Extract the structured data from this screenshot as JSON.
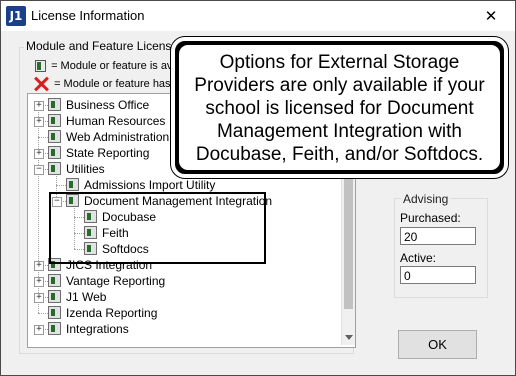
{
  "window": {
    "title": "License Information",
    "app_icon_text": "J1",
    "close_glyph": "✕"
  },
  "group": {
    "title": "Module and Feature Licenses",
    "legend_licensed": "= Module or feature is ava",
    "legend_unlicensed": "= Module or feature has n"
  },
  "tree": {
    "items": [
      {
        "label": "Business Office",
        "level": 0,
        "expander": "+"
      },
      {
        "label": "Human Resources",
        "level": 0,
        "expander": "+"
      },
      {
        "label": "Web Administration",
        "level": 0,
        "expander": ""
      },
      {
        "label": "State Reporting",
        "level": 0,
        "expander": "+"
      },
      {
        "label": "Utilities",
        "level": 0,
        "expander": "−"
      },
      {
        "label": "Admissions Import Utility",
        "level": 1,
        "expander": ""
      },
      {
        "label": "Document Management Integration",
        "level": 1,
        "expander": "−"
      },
      {
        "label": "Docubase",
        "level": 2,
        "expander": ""
      },
      {
        "label": "Feith",
        "level": 2,
        "expander": ""
      },
      {
        "label": "Softdocs",
        "level": 2,
        "expander": ""
      },
      {
        "label": "JICS Integration",
        "level": 0,
        "expander": "+"
      },
      {
        "label": "Vantage Reporting",
        "level": 0,
        "expander": "+"
      },
      {
        "label": "J1 Web",
        "level": 0,
        "expander": "+"
      },
      {
        "label": "Izenda Reporting",
        "level": 0,
        "expander": ""
      },
      {
        "label": "Integrations",
        "level": 0,
        "expander": "+"
      }
    ]
  },
  "advising": {
    "title": "Advising",
    "purchased_label": "Purchased:",
    "purchased_value": "20",
    "active_label": "Active:",
    "active_value": "0"
  },
  "ok_label": "OK",
  "callout": {
    "text": "Options for External Storage Providers are only available if your school is licensed for Document Management Integration with Docubase, Feith, and/or Softdocs."
  }
}
